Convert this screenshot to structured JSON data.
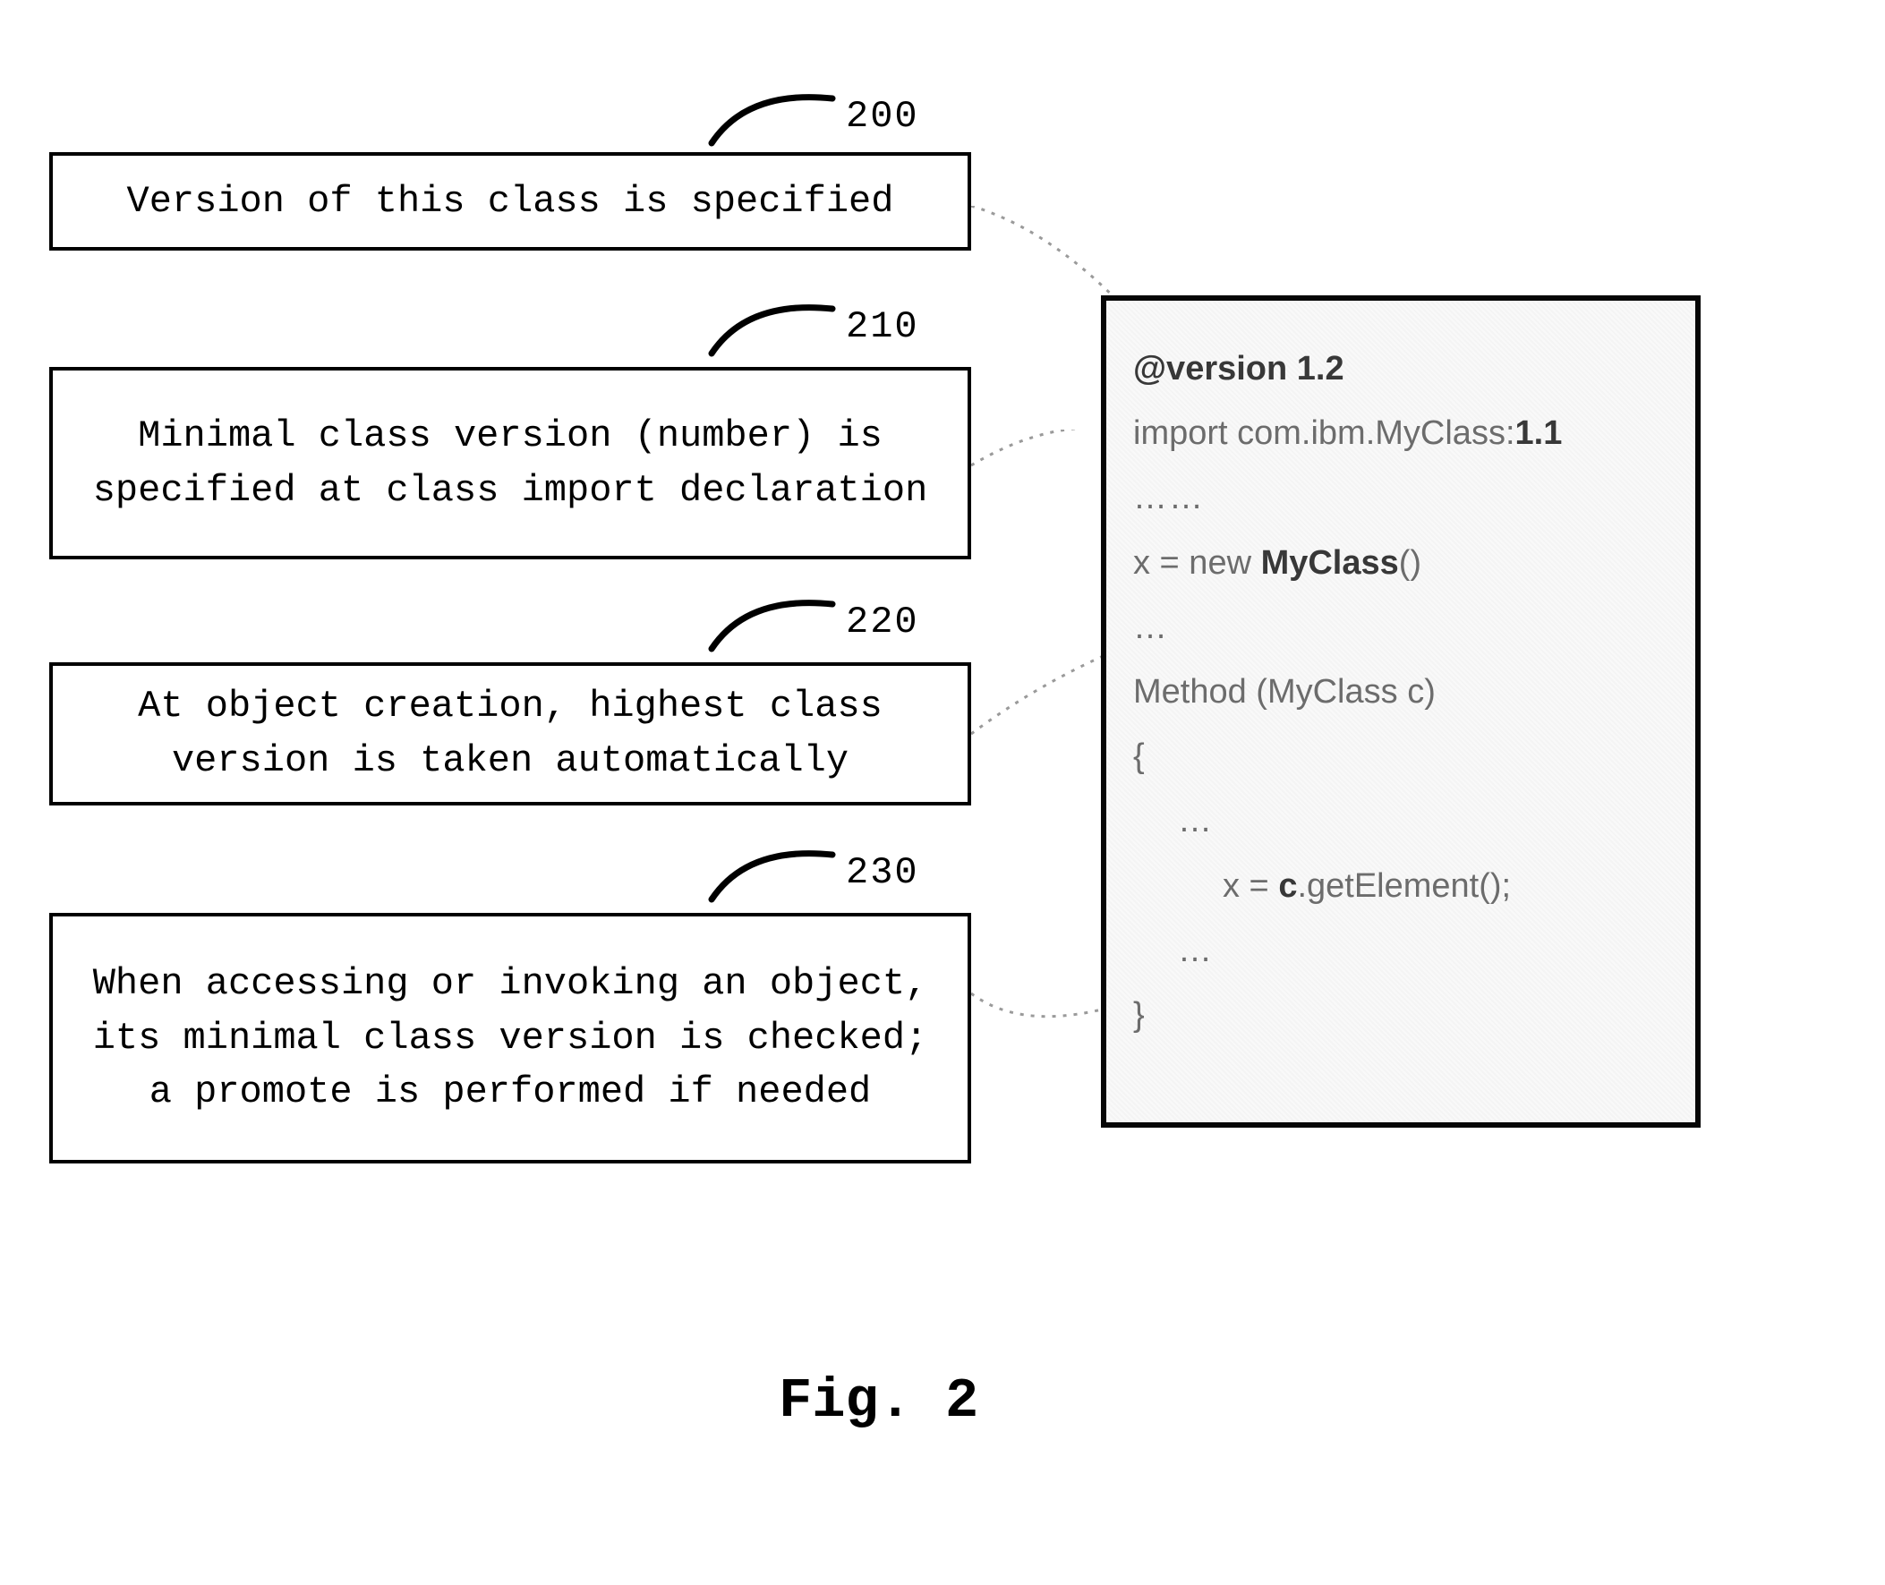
{
  "refs": {
    "b200": "200",
    "b210": "210",
    "b220": "220",
    "b230": "230"
  },
  "boxes": {
    "b200": "Version of this class is specified",
    "b210": "Minimal class version (number) is specified at class import declaration",
    "b220": "At object creation, highest class version is taken automatically",
    "b230": "When accessing or invoking an object, its minimal class version is checked; a promote is performed if needed"
  },
  "code": {
    "l1a": "@version ",
    "l1b": "1.2",
    "l2a": "import com.ibm.MyClass:",
    "l2b": "1.1",
    "l3": "……",
    "l4a": "x = new ",
    "l4b": "MyClass",
    "l4c": "()",
    "l5": "…",
    "l6": "Method (MyClass c)",
    "l7": "{",
    "l8": "…",
    "l9a": "x = ",
    "l9b": "c",
    "l9c": ".getElement();",
    "l10": "…",
    "l11": "}"
  },
  "caption": "Fig. 2"
}
